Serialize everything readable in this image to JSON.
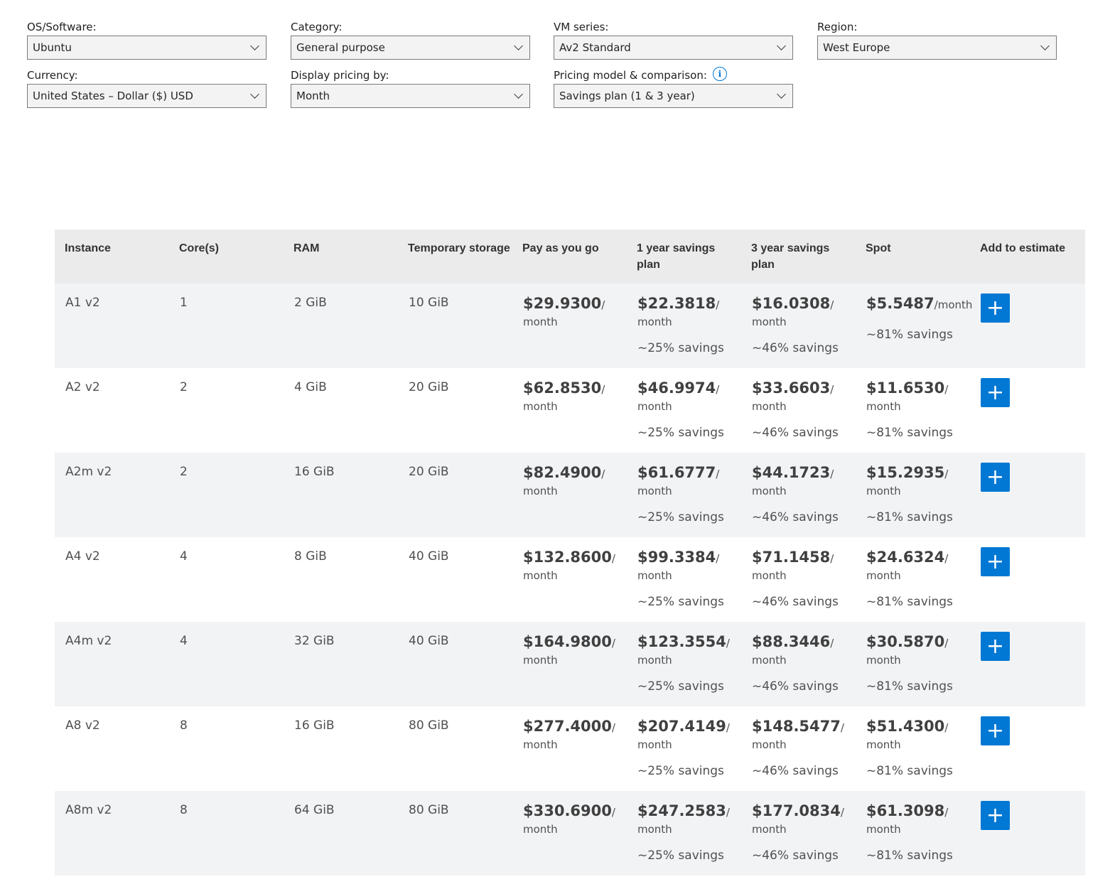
{
  "filters": {
    "os": {
      "label": "OS/Software:",
      "value": "Ubuntu"
    },
    "category": {
      "label": "Category:",
      "value": "General purpose"
    },
    "vm_series": {
      "label": "VM series:",
      "value": "Av2 Standard"
    },
    "region": {
      "label": "Region:",
      "value": "West Europe"
    },
    "currency": {
      "label": "Currency:",
      "value": "United States – Dollar ($) USD"
    },
    "display": {
      "label": "Display pricing by:",
      "value": "Month"
    },
    "pricing_model": {
      "label": "Pricing model & comparison:",
      "value": "Savings plan (1 & 3 year)"
    }
  },
  "table": {
    "headers": [
      "Instance",
      "Core(s)",
      "RAM",
      "Temporary storage",
      "Pay as you go",
      "1 year savings plan",
      "3 year savings plan",
      "Spot",
      "Add to estimate"
    ],
    "rows": [
      {
        "instance": "A1 v2",
        "cores": "1",
        "ram": "2 GiB",
        "storage": "10 GiB",
        "payg": "$29.9300",
        "y1": "$22.3818",
        "y1_sav": "~25% savings",
        "y3": "$16.0308",
        "y3_sav": "~46% savings",
        "spot": "$5.5487",
        "spot_sav": "~81% savings"
      },
      {
        "instance": "A2 v2",
        "cores": "2",
        "ram": "4 GiB",
        "storage": "20 GiB",
        "payg": "$62.8530",
        "y1": "$46.9974",
        "y1_sav": "~25% savings",
        "y3": "$33.6603",
        "y3_sav": "~46% savings",
        "spot": "$11.6530",
        "spot_sav": "~81% savings"
      },
      {
        "instance": "A2m v2",
        "cores": "2",
        "ram": "16 GiB",
        "storage": "20 GiB",
        "payg": "$82.4900",
        "y1": "$61.6777",
        "y1_sav": "~25% savings",
        "y3": "$44.1723",
        "y3_sav": "~46% savings",
        "spot": "$15.2935",
        "spot_sav": "~81% savings"
      },
      {
        "instance": "A4 v2",
        "cores": "4",
        "ram": "8 GiB",
        "storage": "40 GiB",
        "payg": "$132.8600",
        "y1": "$99.3384",
        "y1_sav": "~25% savings",
        "y3": "$71.1458",
        "y3_sav": "~46% savings",
        "spot": "$24.6324",
        "spot_sav": "~81% savings"
      },
      {
        "instance": "A4m v2",
        "cores": "4",
        "ram": "32 GiB",
        "storage": "40 GiB",
        "payg": "$164.9800",
        "y1": "$123.3554",
        "y1_sav": "~25% savings",
        "y3": "$88.3446",
        "y3_sav": "~46% savings",
        "spot": "$30.5870",
        "spot_sav": "~81% savings"
      },
      {
        "instance": "A8 v2",
        "cores": "8",
        "ram": "16 GiB",
        "storage": "80 GiB",
        "payg": "$277.4000",
        "y1": "$207.4149",
        "y1_sav": "~25% savings",
        "y3": "$148.5477",
        "y3_sav": "~46% savings",
        "spot": "$51.4300",
        "spot_sav": "~81% savings"
      },
      {
        "instance": "A8m v2",
        "cores": "8",
        "ram": "64 GiB",
        "storage": "80 GiB",
        "payg": "$330.6900",
        "y1": "$247.2583",
        "y1_sav": "~25% savings",
        "y3": "$177.0834",
        "y3_sav": "~46% savings",
        "spot": "$61.3098",
        "spot_sav": "~81% savings"
      }
    ],
    "slash": "/",
    "unit": "month",
    "spot_unit_inline": "/month",
    "add_label": "+"
  }
}
